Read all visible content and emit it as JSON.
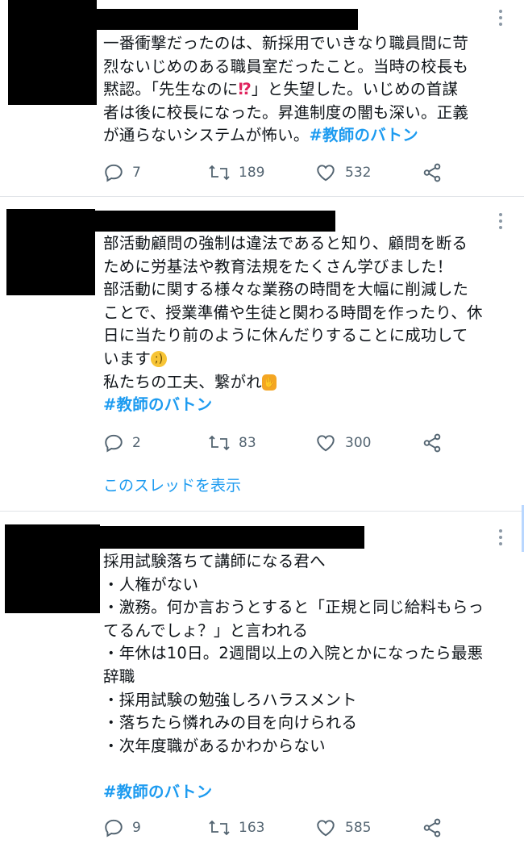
{
  "tweets": [
    {
      "lines": [
        "一番衝撃だったのは、新採用でいきなり職員間に苛",
        "烈ないじめのある職員室だったこと。当時の校長も",
        "黙認。「先生なのに",
        "」と失望した。いじめの首謀",
        "者は後に校長になった。昇進制度の闇も深い。正義",
        "が通らないシステムが怖い。",
        "#教師のバトン"
      ],
      "emoji_interrobang": "⁉",
      "replies": "7",
      "retweets": "189",
      "likes": "532"
    },
    {
      "lines": [
        "部活動顧問の強制は違法であると知り、顧問を断る",
        "ために労基法や教育法規をたくさん学びました！",
        "部活動に関する様々な業務の時間を大幅に削減した",
        "ことで、授業準備や生徒と関わる時間を作ったり、休",
        "日に当たり前のように休んだりすることに成功して",
        "います",
        "私たちの工夫、繋がれ",
        "#教師のバトン"
      ],
      "emoji_wink": ";)",
      "emoji_person": "✋",
      "replies": "2",
      "retweets": "83",
      "likes": "300",
      "thread_link": "このスレッドを表示"
    },
    {
      "lines": [
        "採用試験落ちて講師になる君へ",
        "・人権がない",
        "・激務。何か言おうとすると「正規と同じ給料もらっ",
        "てるんでしょ？」と言われる",
        "・年休は10日。2週間以上の入院とかになったら最悪",
        "辞職",
        "・採用試験の勉強しろハラスメント",
        "・落ちたら憐れみの目を向けられる",
        "・次年度職があるかわからない",
        "#教師のバトン"
      ],
      "replies": "9",
      "retweets": "163",
      "likes": "585"
    }
  ],
  "icons": {
    "reply": "reply-icon",
    "retweet": "retweet-icon",
    "like": "heart-icon",
    "share": "share-icon",
    "more": "more-icon"
  },
  "colors": {
    "accent": "#1d9bf0",
    "muted": "#536471",
    "divider": "#e1e4e8"
  }
}
